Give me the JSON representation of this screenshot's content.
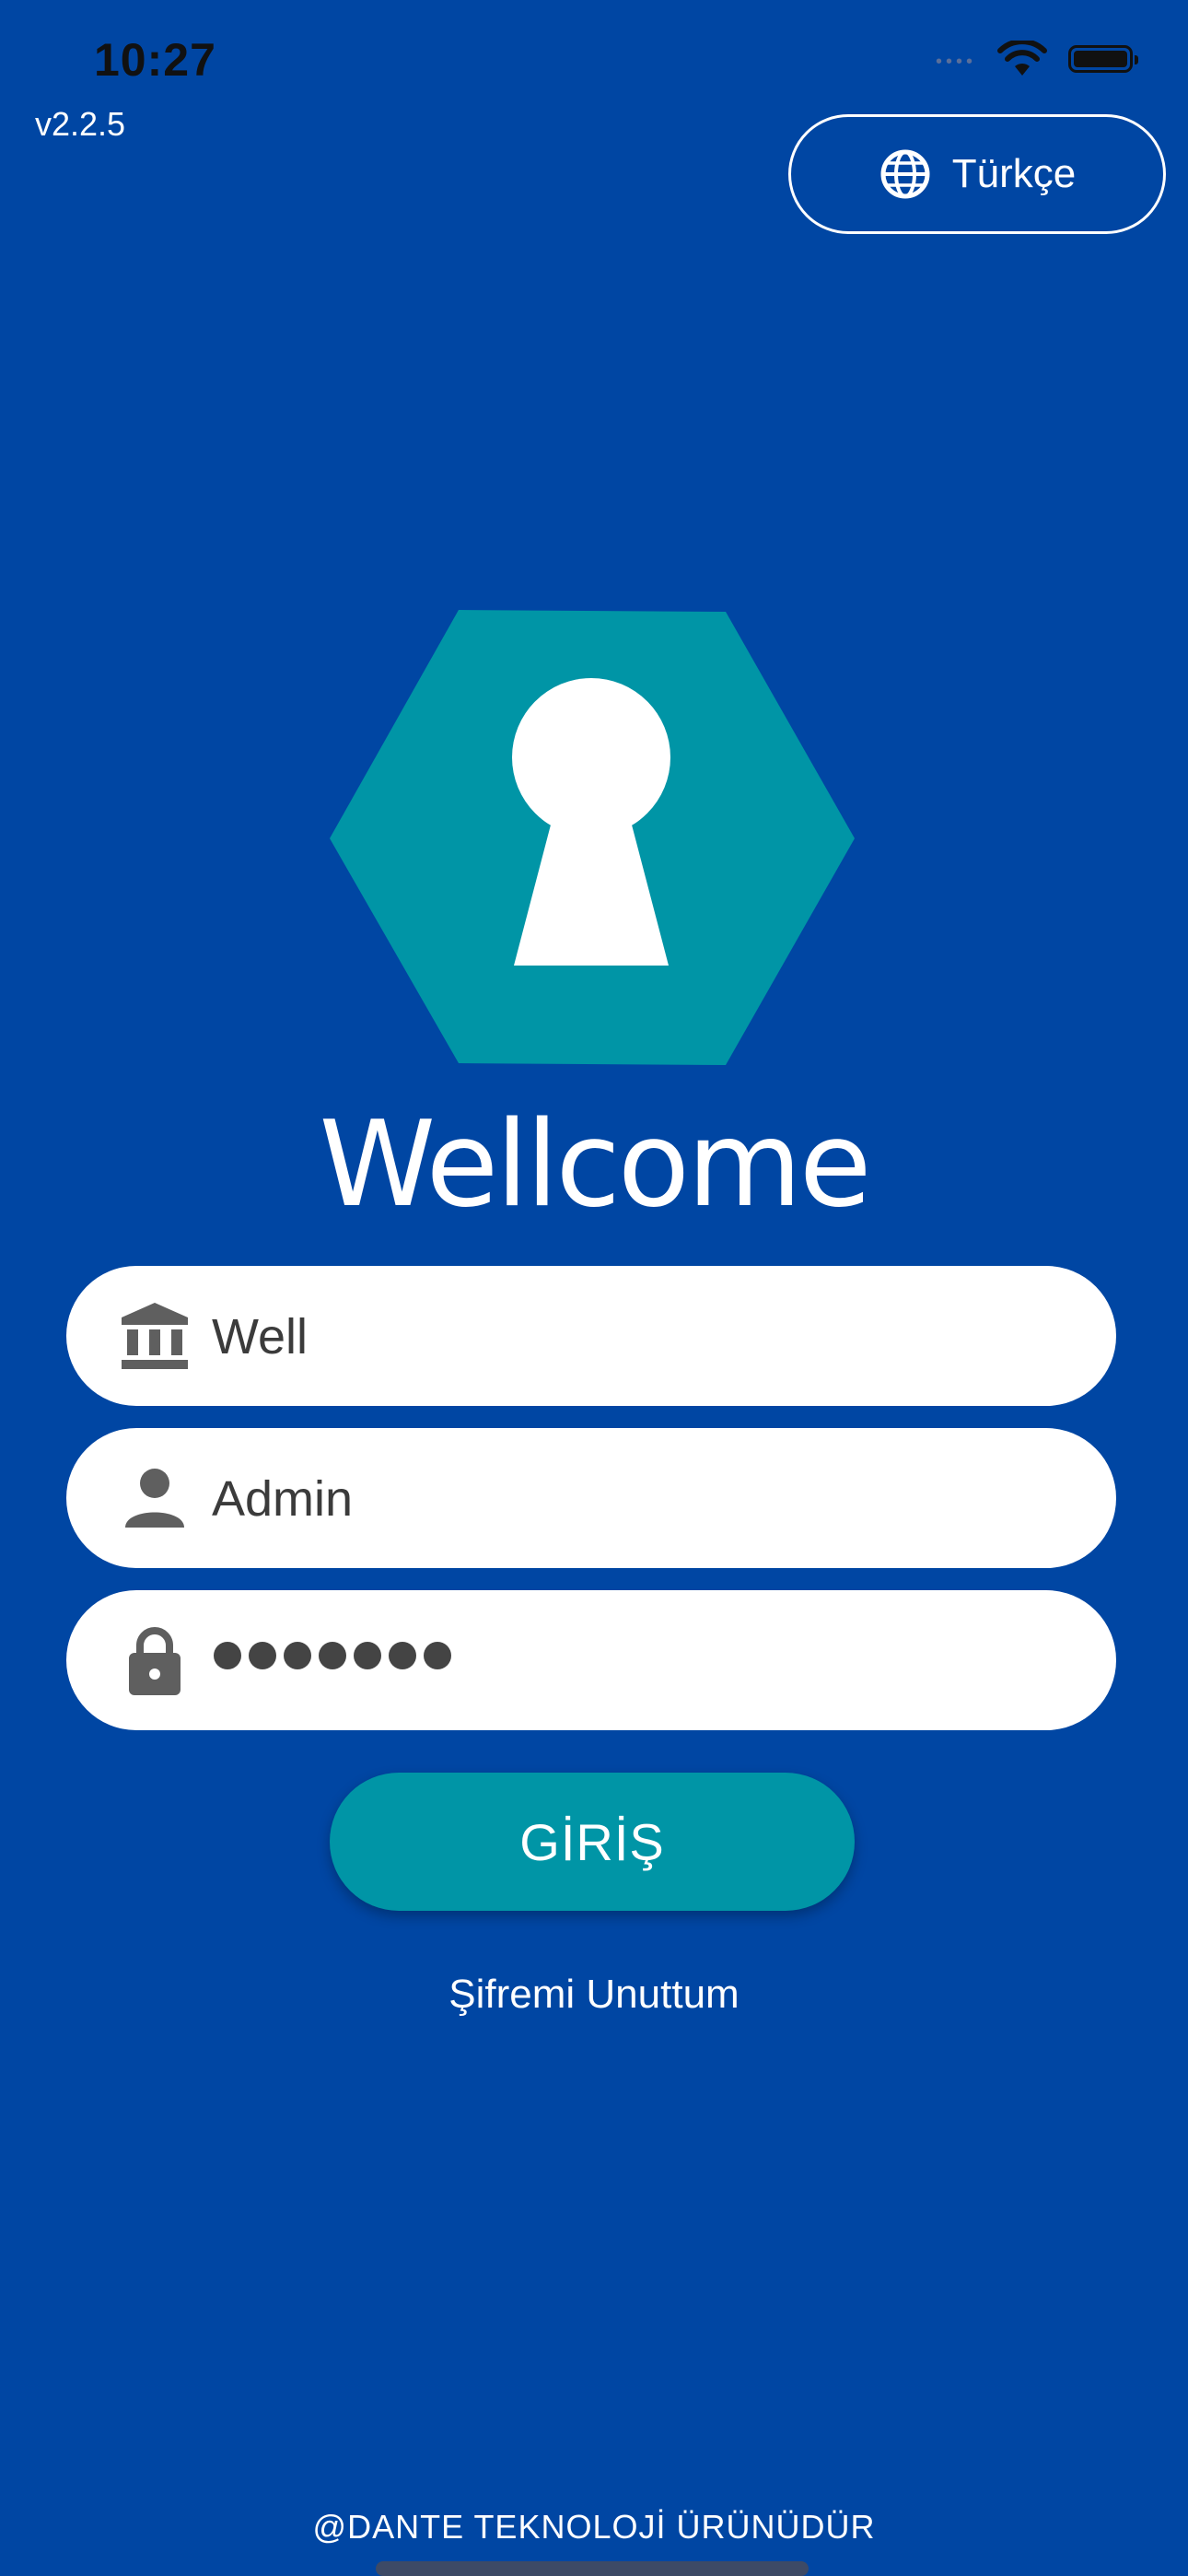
{
  "status_bar": {
    "time": "10:27",
    "icons": [
      "cellular-signal-icon",
      "wifi-icon",
      "battery-icon"
    ]
  },
  "app": {
    "version": "v2.2.5",
    "welcome_title": "Wellcome",
    "logo_icon": "keyhole-hexagon-logo"
  },
  "language_button": {
    "icon": "globe-icon",
    "label": "Türkçe"
  },
  "form": {
    "company_field": {
      "icon": "institution-icon",
      "value": "Well"
    },
    "username_field": {
      "icon": "person-icon",
      "value": "Admin"
    },
    "password_field": {
      "icon": "lock-icon",
      "masked_length": 7
    },
    "submit_label": "GİRİŞ",
    "forgot_password_label": "Şifremi Unuttum"
  },
  "footer": {
    "text": "@DANTE TEKNOLOJİ ÜRÜNÜDÜR"
  },
  "colors": {
    "background": "#0046A3",
    "accent": "#0095A6",
    "field_background": "#FFFFFF",
    "icon_gray": "#5F5F5F"
  }
}
